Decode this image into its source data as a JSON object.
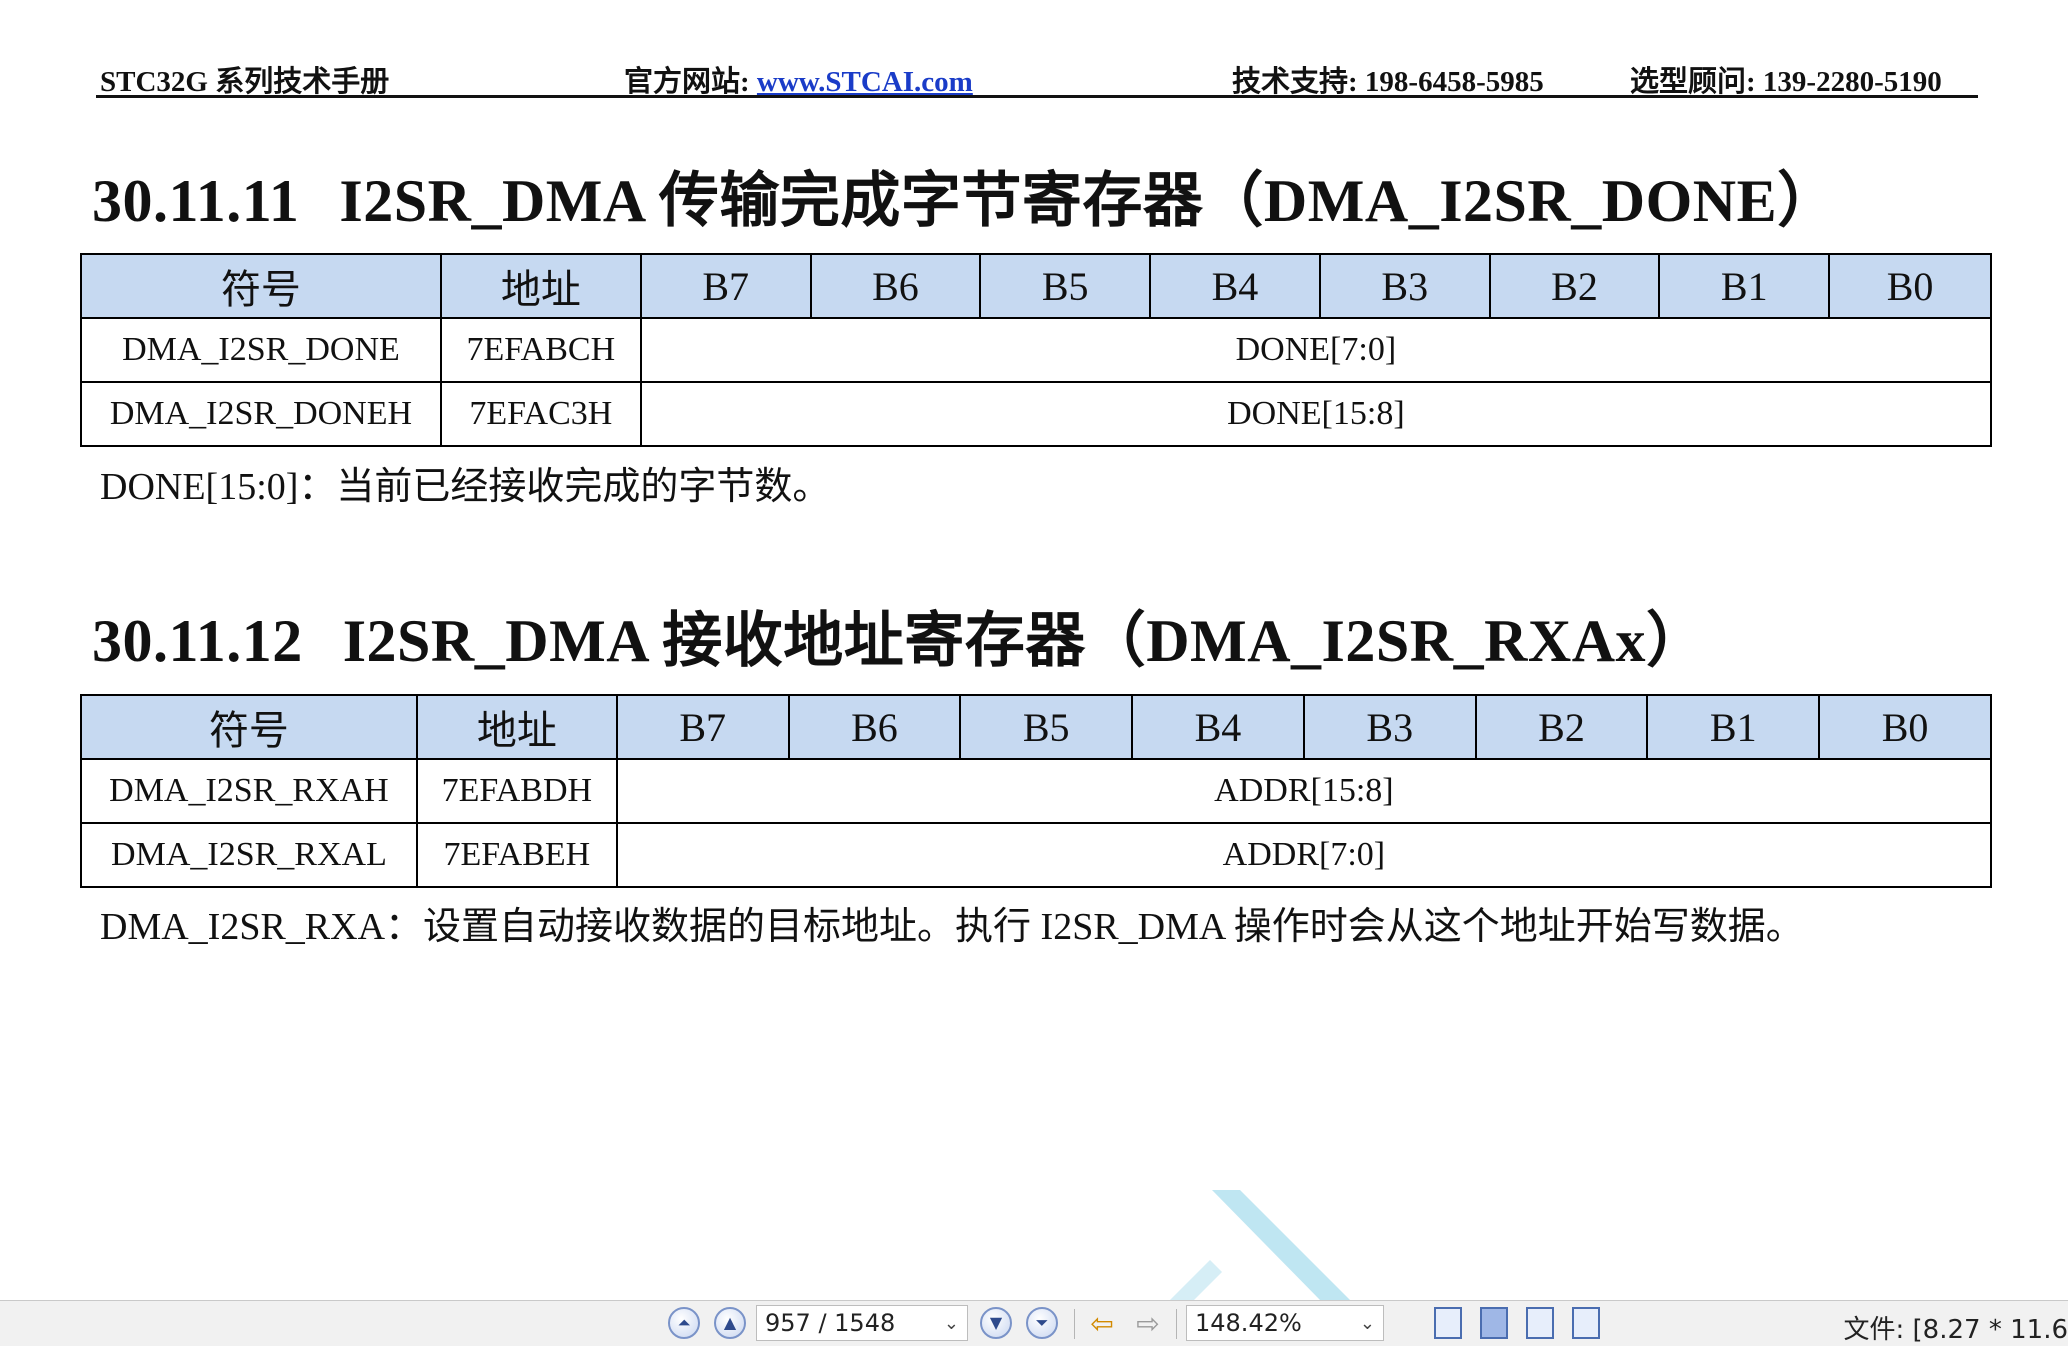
{
  "header": {
    "manual": "STC32G 系列技术手册",
    "site_label": "官方网站: ",
    "site_link": "www.STCAI.com",
    "support": "技术支持: 198-6458-5985",
    "selection": "选型顾问: 139-2280-5190"
  },
  "sections": [
    {
      "number": "30.11.11",
      "title": "I2SR_DMA 传输完成字节寄存器（DMA_I2SR_DONE）",
      "columns": [
        "符号",
        "地址",
        "B7",
        "B6",
        "B5",
        "B4",
        "B3",
        "B2",
        "B1",
        "B0"
      ],
      "rows": [
        {
          "symbol": "DMA_I2SR_DONE",
          "address": "7EFABCH",
          "field": "DONE[7:0]"
        },
        {
          "symbol": "DMA_I2SR_DONEH",
          "address": "7EFAC3H",
          "field": "DONE[15:8]"
        }
      ],
      "description": "DONE[15:0]：当前已经接收完成的字节数。"
    },
    {
      "number": "30.11.12",
      "title": "I2SR_DMA 接收地址寄存器（DMA_I2SR_RXAx）",
      "columns": [
        "符号",
        "地址",
        "B7",
        "B6",
        "B5",
        "B4",
        "B3",
        "B2",
        "B1",
        "B0"
      ],
      "rows": [
        {
          "symbol": "DMA_I2SR_RXAH",
          "address": "7EFABDH",
          "field": "ADDR[15:8]"
        },
        {
          "symbol": "DMA_I2SR_RXAL",
          "address": "7EFABEH",
          "field": "ADDR[7:0]"
        }
      ],
      "description": "DMA_I2SR_RXA：设置自动接收数据的目标地址。执行 I2SR_DMA 操作时会从这个地址开始写数据。"
    }
  ],
  "toolbar": {
    "page_indicator": "957 / 1548",
    "zoom": "148.42%",
    "status": "文件: [8.27 * 11.6"
  },
  "icons": {
    "first_page": "first-page-icon",
    "prev_page": "previous-page-icon",
    "next_page": "next-page-icon",
    "last_page": "last-page-icon",
    "back": "back-arrow-icon",
    "forward": "forward-arrow-icon",
    "single_page_view": "single-page-view-icon",
    "continuous_view": "continuous-view-icon",
    "facing_view": "facing-view-icon",
    "continuous_facing_view": "continuous-facing-view-icon"
  },
  "colors": {
    "table_header_bg": "#c6d9f1",
    "link": "#1a3cc8",
    "watermark": "#bfe6f2"
  }
}
